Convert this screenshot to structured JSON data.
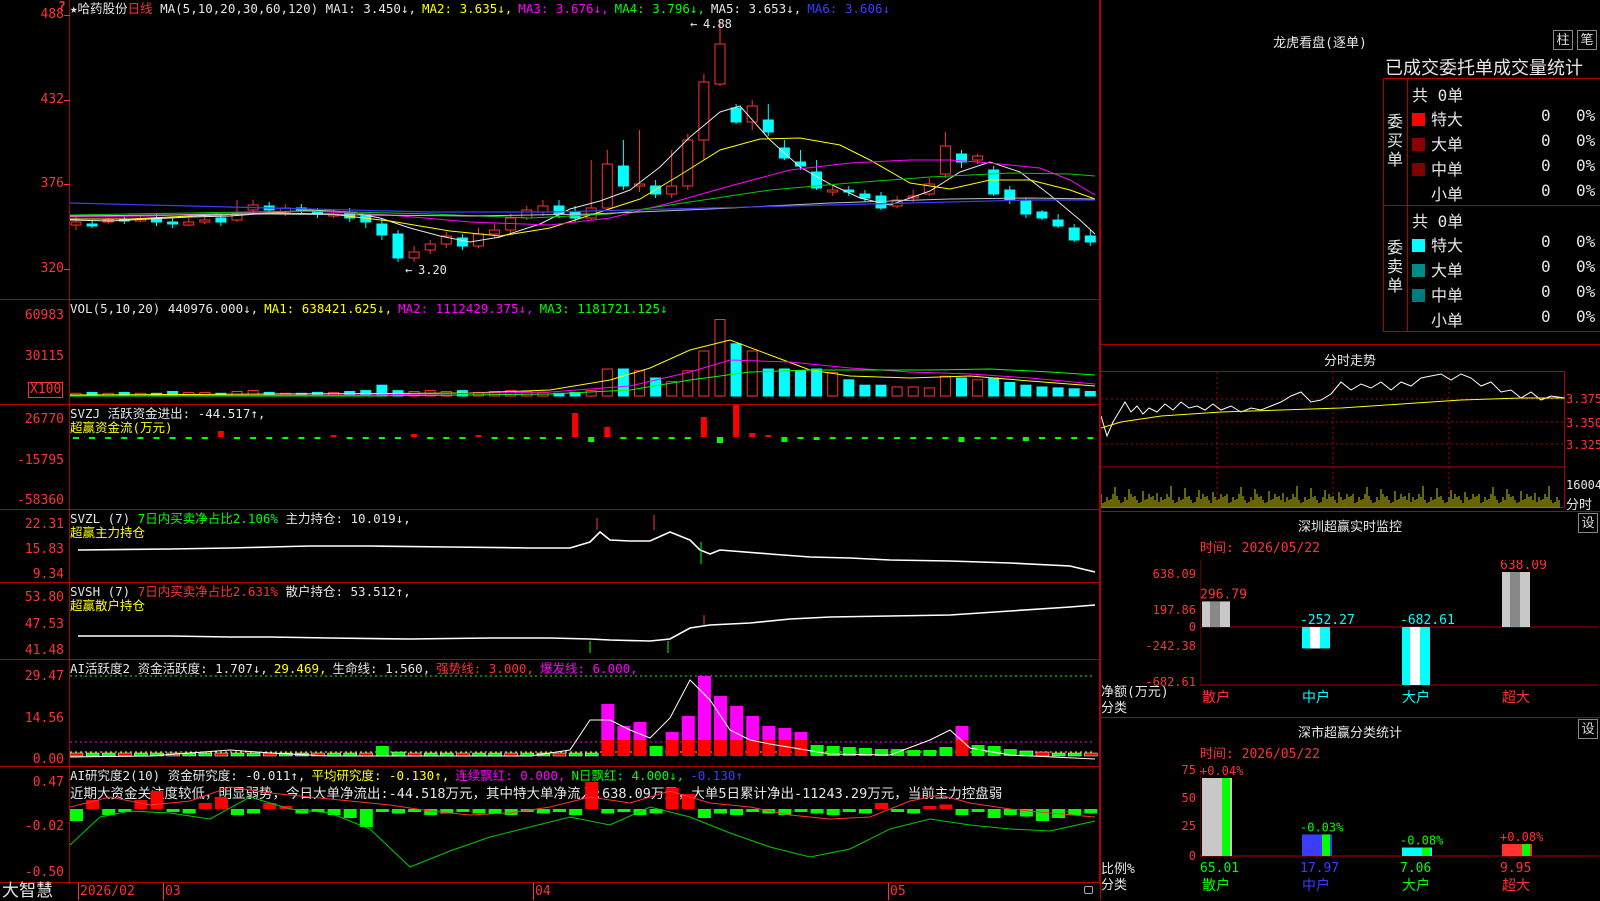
{
  "stock": {
    "star": "★",
    "name": "哈药股份",
    "period": "日线",
    "corner_mark": "?"
  },
  "ma_header": {
    "label": "MA(5,10,20,30,60,120)",
    "items": [
      {
        "t": "MA1: 3.450↓,",
        "c": "#e6e6e6"
      },
      {
        "t": "MA2: 3.635↓,",
        "c": "#ffff00"
      },
      {
        "t": "MA3: 3.676↓,",
        "c": "#ff00ff"
      },
      {
        "t": "MA4: 3.796↓,",
        "c": "#00ff00"
      },
      {
        "t": "MA5: 3.653↓,",
        "c": "#e6e6e6"
      },
      {
        "t": "MA6: 3.606↓",
        "c": "#3c3cff"
      }
    ]
  },
  "price_axis": [
    "488",
    "432",
    "376",
    "320"
  ],
  "price_annotations": {
    "high": "4.88",
    "low": "3.20"
  },
  "vol_header": {
    "label": "VOL(5,10,20)",
    "items": [
      {
        "t": "440976.000↓,",
        "c": "#e6e6e6"
      },
      {
        "t": "MA1: 638421.625↓,",
        "c": "#ffff00"
      },
      {
        "t": "MA2: 1112429.375↓,",
        "c": "#ff00ff"
      },
      {
        "t": "MA3: 1181721.125↓",
        "c": "#00ff00"
      }
    ]
  },
  "vol_axis": [
    "60983",
    "30115"
  ],
  "vol_unit": "X100",
  "svzj": {
    "line1": "SVZJ  活跃资金进出: -44.517↑,",
    "line2": "超赢资金流(万元)",
    "axis": [
      "26770",
      "-15795",
      "-58360"
    ]
  },
  "svzl": {
    "name": "SVZL (7)",
    "net": "7日内买卖净占比2.106%",
    "hold": "主力持仓: 10.019↓,",
    "line2": "超赢主力持仓",
    "axis": [
      "22.31",
      "15.83",
      "9.34"
    ]
  },
  "svsh": {
    "name": "SVSH (7)",
    "net": "7日内买卖净占比2.631%",
    "hold": "散户持仓: 53.512↑,",
    "line2": "超赢散户持仓",
    "axis": [
      "53.80",
      "47.53",
      "41.48"
    ]
  },
  "ai1": {
    "items": [
      {
        "t": "AI活跃度2 资金活跃度: 1.707↓,",
        "c": "#e6e6e6"
      },
      {
        "t": "29.469,",
        "c": "#ffff00"
      },
      {
        "t": "生命线: 1.560,",
        "c": "#e6e6e6"
      },
      {
        "t": "强势线: 3.000,",
        "c": "#ff3232"
      },
      {
        "t": "爆发线: 6.000,",
        "c": "#ff00ff"
      }
    ],
    "axis": [
      "29.47",
      "14.56",
      "0.00"
    ]
  },
  "ai2": {
    "items": [
      {
        "t": "AI研究度2(10) 资金研究度: -0.011↑,",
        "c": "#e6e6e6"
      },
      {
        "t": "平均研究度: -0.130↑,",
        "c": "#ffff00"
      },
      {
        "t": "连续飘红: 0.000,",
        "c": "#ff00ff"
      },
      {
        "t": "N日飘红: 4.000↓,",
        "c": "#00ff00"
      },
      {
        "t": "-0.130↑",
        "c": "#3c3cff"
      }
    ],
    "comment": "近期大资金关注度较低，明显弱势，今日大单净流出:-44.518万元，其中特大单净流入:638.09万元，大单5日累计净出-11243.29万元，当前主力控盘弱",
    "axis": [
      "0.47",
      "-0.02",
      "-0.50"
    ]
  },
  "bottom": {
    "brand": "大智慧",
    "dates": [
      "2026/02",
      "03",
      "04",
      "05"
    ]
  },
  "lhb": {
    "title": "龙虎看盘(逐单)",
    "btn1": "柱",
    "btn2": "笔",
    "subtitle": "已成交委托单成交量统计",
    "buy_label": [
      "委",
      "买",
      "单"
    ],
    "sell_label": [
      "委",
      "卖",
      "单"
    ],
    "buy_total": "共 0单",
    "sell_total": "共 0单",
    "buy_rows": [
      {
        "name": "特大",
        "n": "0",
        "p": "0%",
        "color": "#ff0000"
      },
      {
        "name": "大单",
        "n": "0",
        "p": "0%",
        "color": "#8b0000"
      },
      {
        "name": "中单",
        "n": "0",
        "p": "0%",
        "color": "#800000"
      },
      {
        "name": "小单",
        "n": "0",
        "p": "0%",
        "color": ""
      }
    ],
    "sell_rows": [
      {
        "name": "特大",
        "n": "0",
        "p": "0%",
        "color": "#00ffff"
      },
      {
        "name": "大单",
        "n": "0",
        "p": "0%",
        "color": "#008b8b"
      },
      {
        "name": "中单",
        "n": "0",
        "p": "0%",
        "color": "#007b7b"
      },
      {
        "name": "小单",
        "n": "0",
        "p": "0%",
        "color": ""
      }
    ]
  },
  "fenshi": {
    "title": "分时走势",
    "axis": [
      "3.375",
      "3.350",
      "3.325"
    ],
    "vol_axis": "16004",
    "vol_label": "分时"
  },
  "monitor": {
    "title": "深圳超赢实时监控",
    "btn": "设",
    "time": "时间: 2026/05/22",
    "axis": [
      "638.09",
      "197.86",
      "0",
      "-242.38",
      "-682.61"
    ],
    "ylabel_1": "净额(万元)",
    "ylabel_2": "分类",
    "categories": [
      "散户",
      "中户",
      "大户",
      "超大"
    ],
    "values": [
      296.79,
      -252.27,
      -682.61,
      638.09
    ],
    "value_labels": [
      "296.79",
      "-252.27",
      "-682.61",
      "638.09"
    ]
  },
  "classify": {
    "title": "深市超赢分类统计",
    "btn": "设",
    "time": "时间: 2026/05/22",
    "axis": [
      "75",
      "50",
      "25",
      "0"
    ],
    "ylabel_1": "比例%",
    "ylabel_2": "分类",
    "categories": [
      "散户",
      "中户",
      "大户",
      "超大"
    ],
    "values": [
      65.01,
      17.97,
      7.06,
      9.95
    ],
    "value_labels": [
      "65.01",
      "17.97",
      "7.06",
      "9.95"
    ],
    "changes": [
      "+0.04%",
      "-0.03%",
      "-0.08%",
      "+0.08%"
    ]
  },
  "chart_data": {
    "type": "bar",
    "title": "深圳超赢实时监控",
    "categories": [
      "散户",
      "中户",
      "大户",
      "超大"
    ],
    "series": [
      {
        "name": "净额(万元)",
        "values": [
          296.79,
          -252.27,
          -682.61,
          638.09
        ]
      }
    ],
    "ylim": [
      -682.61,
      638.09
    ]
  }
}
